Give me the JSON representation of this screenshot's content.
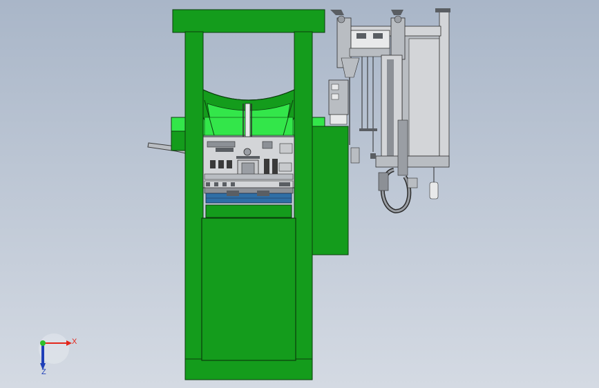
{
  "scene": {
    "colors": {
      "frame": "#149c1c",
      "frame_edge": "#0b3d0d",
      "frame_light": "#33e64a",
      "steel": "#b9bdc2",
      "steel_dark": "#5a5e63",
      "panel": "#d3d5d8",
      "tray_blue": "#2f6fa6",
      "line": "#2b2b2b"
    }
  },
  "axes": {
    "x_label": "X",
    "z_label": "Z",
    "x_color": "#e3261b",
    "y_color": "#2fbf2a",
    "z_color": "#1f3fb8"
  }
}
